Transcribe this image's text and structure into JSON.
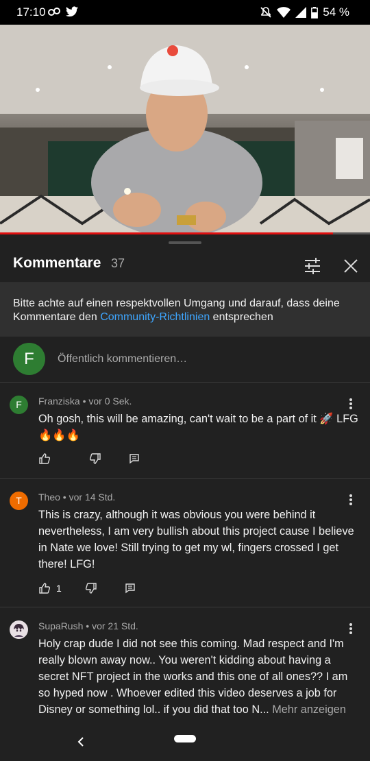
{
  "status": {
    "time": "17:10",
    "battery": "54 %"
  },
  "video": {
    "progress": 0.9
  },
  "sheet": {
    "title": "Kommentare",
    "count": "37"
  },
  "guideline": {
    "text_before": "Bitte achte auf einen respektvollen Umgang und darauf, dass deine Kommentare den ",
    "link": "Community-Richtlinien",
    "text_after": " entsprechen"
  },
  "add_comment": {
    "avatar_letter": "F",
    "placeholder": "Öffentlich kommentieren…"
  },
  "comments": [
    {
      "avatar_letter": "F",
      "avatar_color": "#2e7d32",
      "author": "Franziska",
      "time": "vor 0 Sek.",
      "text": "Oh gosh, this will be amazing, can't wait to be a part of it 🚀 LFG 🔥🔥🔥",
      "likes": ""
    },
    {
      "avatar_letter": "T",
      "avatar_color": "#ef6c00",
      "author": "Theo",
      "time": "vor 14 Std.",
      "text": "This is crazy, although it was obvious you were behind it nevertheless, I am very bullish about this project cause I believe in Nate we love! Still trying to get my wl, fingers crossed I get there! LFG!",
      "likes": "1"
    },
    {
      "avatar_letter": "",
      "avatar_color": "#e8e0e4",
      "author": "SupaRush",
      "time": "vor 21 Std.",
      "text": "Holy crap dude I did not see this coming.  Mad respect and I'm really blown away now..  You weren't kidding about having a secret NFT project in the works and this one of all ones?? I am so hyped now . Whoever edited this video deserves a job for Disney or something lol.. if you did that too N...",
      "more": "Mehr anzeigen",
      "likes": ""
    }
  ],
  "meta_separator": " • "
}
